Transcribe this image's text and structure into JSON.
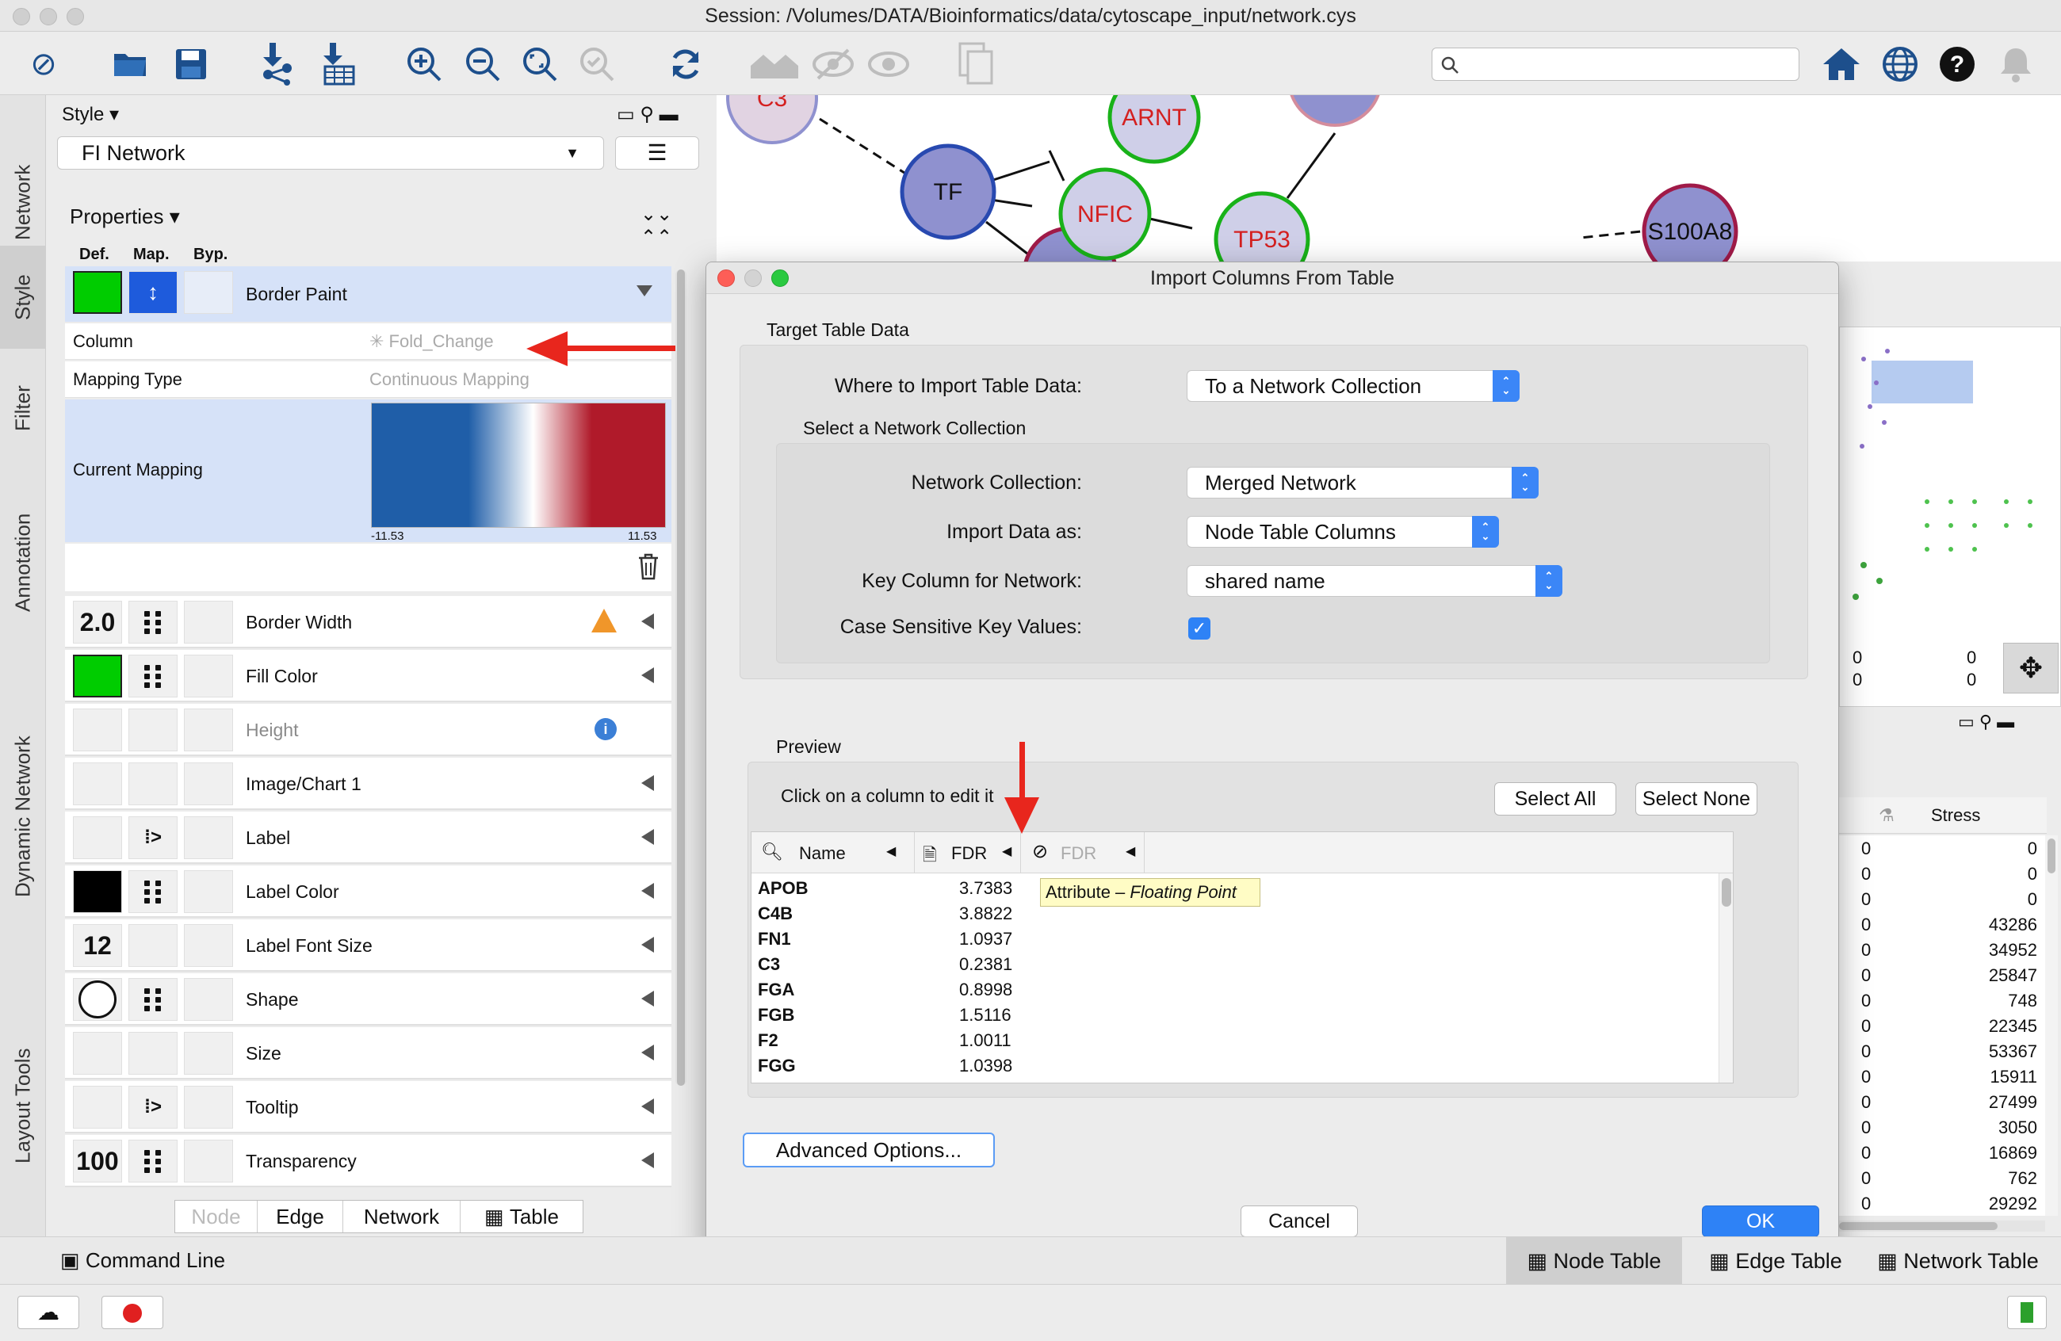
{
  "window": {
    "title": "Session: /Volumes/DATA/Bioinformatics/data/cytoscape_input/network.cys"
  },
  "toolbar": {
    "icons": [
      "cytoscape-logo-icon",
      "open-folder-icon",
      "save-icon",
      "import-network-icon",
      "import-table-icon",
      "zoom-in-icon",
      "zoom-out-icon",
      "zoom-fit-icon",
      "zoom-selected-icon",
      "refresh-icon",
      "show-all-icon",
      "hide-icon",
      "show-icon",
      "duplicate-icon",
      "home-icon",
      "globe-icon",
      "help-icon",
      "notifications-icon"
    ],
    "search_placeholder": ""
  },
  "left_tabs": [
    "Network",
    "Style",
    "Filter",
    "Annotation",
    "Dynamic Network",
    "Layout Tools"
  ],
  "style_panel": {
    "header": "Style",
    "style_name": "FI Network",
    "properties_label": "Properties",
    "col_def": "Def.",
    "col_map": "Map.",
    "col_byp": "Byp.",
    "border_paint": {
      "label": "Border Paint",
      "column_label": "Column",
      "column_value": "Fold_Change",
      "mapping_type_label": "Mapping Type",
      "mapping_type_value": "Continuous Mapping",
      "current_mapping_label": "Current Mapping",
      "min": "-11.53",
      "max": "11.53"
    },
    "rows": [
      {
        "name": "border-width",
        "label": "Border Width",
        "def": "2.0",
        "map": "dots",
        "warn": true
      },
      {
        "name": "fill-color",
        "label": "Fill Color",
        "def": "green",
        "map": "dots"
      },
      {
        "name": "height",
        "label": "Height",
        "def": "",
        "map": "",
        "info": true,
        "disabled": true
      },
      {
        "name": "image-chart",
        "label": "Image/Chart 1",
        "def": "",
        "map": ""
      },
      {
        "name": "label",
        "label": "Label",
        "def": "",
        "map": "passthrough"
      },
      {
        "name": "label-color",
        "label": "Label Color",
        "def": "black",
        "map": "dots"
      },
      {
        "name": "label-font-size",
        "label": "Label Font Size",
        "def": "12",
        "map": ""
      },
      {
        "name": "shape",
        "label": "Shape",
        "def": "circle",
        "map": "dots"
      },
      {
        "name": "size",
        "label": "Size",
        "def": "",
        "map": ""
      },
      {
        "name": "tooltip",
        "label": "Tooltip",
        "def": "",
        "map": "passthrough"
      },
      {
        "name": "transparency",
        "label": "Transparency",
        "def": "100",
        "map": "dots"
      }
    ],
    "bottom_tabs": [
      "Node",
      "Edge",
      "Network",
      "Table"
    ]
  },
  "network": {
    "nodes": [
      {
        "label": "C3"
      },
      {
        "label": "ARNT"
      },
      {
        "label": "TF"
      },
      {
        "label": "NFIC"
      },
      {
        "label": "TP53"
      },
      {
        "label": "S100A8"
      }
    ]
  },
  "dialog": {
    "title": "Import Columns From Table",
    "target_group": "Target Table Data",
    "where_label": "Where to Import Table Data:",
    "where_value": "To a Network Collection",
    "select_collection": "Select a Network Collection",
    "collection_label": "Network Collection:",
    "collection_value": "Merged Network",
    "import_as_label": "Import Data as:",
    "import_as_value": "Node Table Columns",
    "key_label": "Key Column for Network:",
    "key_value": "shared name",
    "case_label": "Case Sensitive Key Values:",
    "case_checked": true,
    "preview_label": "Preview",
    "click_hint": "Click on a column to edit it",
    "select_all": "Select All",
    "select_none": "Select None",
    "columns": [
      "Name",
      "FDR",
      "FDR"
    ],
    "tooltip_prefix": "Attribute – ",
    "tooltip_type": "Floating Point",
    "preview_rows": [
      {
        "name": "APOB",
        "fdr": "3.7383"
      },
      {
        "name": "C4B",
        "fdr": "3.8822"
      },
      {
        "name": "FN1",
        "fdr": "1.0937"
      },
      {
        "name": "C3",
        "fdr": "0.2381"
      },
      {
        "name": "FGA",
        "fdr": "0.8998"
      },
      {
        "name": "FGB",
        "fdr": "1.5116"
      },
      {
        "name": "F2",
        "fdr": "1.0011"
      },
      {
        "name": "FGG",
        "fdr": "1.0398"
      }
    ],
    "advanced": "Advanced Options...",
    "cancel": "Cancel",
    "ok": "OK"
  },
  "right_panel": {
    "counters": [
      "0",
      "0",
      "0",
      "0"
    ],
    "stress_header": "Stress",
    "rows": [
      {
        "a": "0",
        "b": "0"
      },
      {
        "a": "0",
        "b": "0"
      },
      {
        "a": "0",
        "b": "0"
      },
      {
        "a": "0",
        "b": "43286"
      },
      {
        "a": "0",
        "b": "34952"
      },
      {
        "a": "0",
        "b": "25847"
      },
      {
        "a": "0",
        "b": "748"
      },
      {
        "a": "0",
        "b": "22345"
      },
      {
        "a": "0",
        "b": "53367"
      },
      {
        "a": "0",
        "b": "15911"
      },
      {
        "a": "0",
        "b": "27499"
      },
      {
        "a": "0",
        "b": "3050"
      },
      {
        "a": "0",
        "b": "16869"
      },
      {
        "a": "0",
        "b": "762"
      },
      {
        "a": "0",
        "b": "29292"
      }
    ]
  },
  "statusbar": {
    "command_line": "Command Line",
    "tabs": [
      "Node Table",
      "Edge Table",
      "Network Table"
    ]
  },
  "colors": {
    "accent": "#2e82f6",
    "green": "#00cc00",
    "mapping_blue": "#1f5ea8",
    "mapping_red": "#b01a2a",
    "arrow": "#e8261d"
  }
}
